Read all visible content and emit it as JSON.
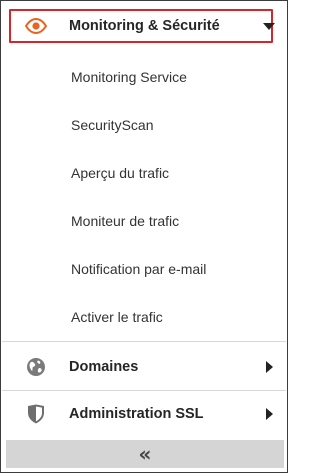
{
  "menu": {
    "active_section": {
      "label": "Monitoring & Sécurité",
      "icon": "eye-icon",
      "icon_color": "#e8641f",
      "highlight_color": "#d7262b",
      "expanded": true,
      "items": [
        {
          "label": "Monitoring Service"
        },
        {
          "label": "SecurityScan"
        },
        {
          "label": "Aperçu du trafic"
        },
        {
          "label": "Moniteur de trafic"
        },
        {
          "label": "Notification par e-mail"
        },
        {
          "label": "Activer le trafic"
        }
      ]
    },
    "sections": [
      {
        "label": "Domaines",
        "icon": "globe-icon"
      },
      {
        "label": "Administration SSL",
        "icon": "shield-icon"
      }
    ],
    "collapse_glyph": "«"
  }
}
